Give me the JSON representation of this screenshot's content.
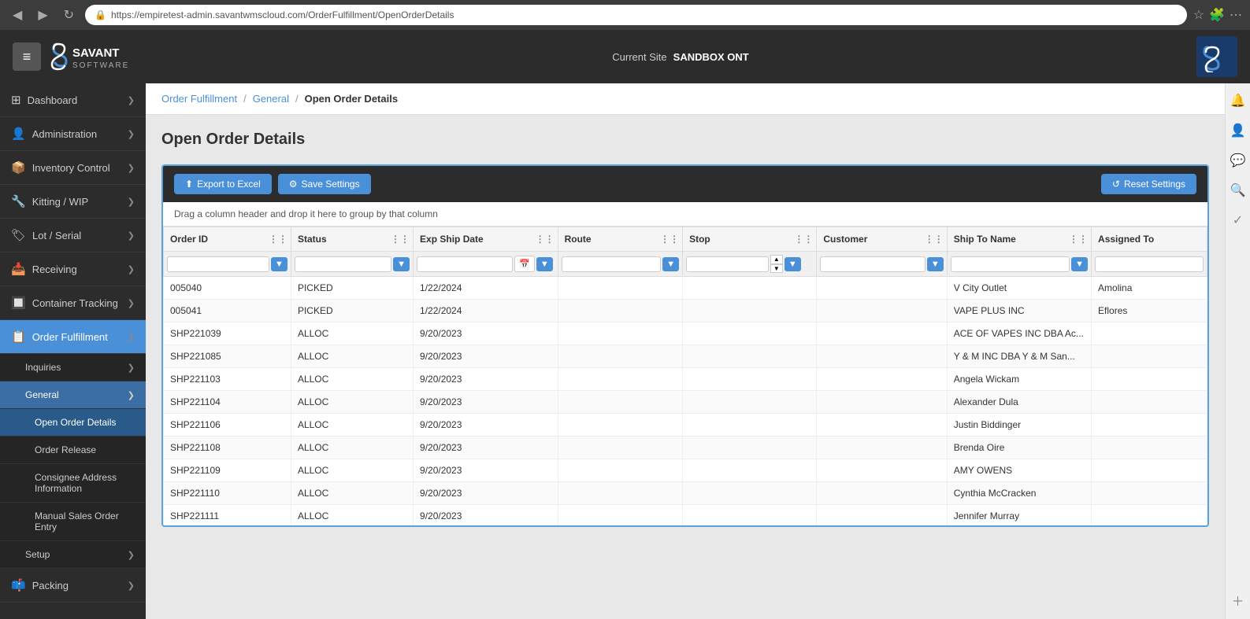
{
  "browser": {
    "url": "https://empiretest-admin.savantwmscloud.com/OrderFulfillment/OpenOrderDetails",
    "back_btn": "◀",
    "forward_btn": "▶",
    "refresh_btn": "↻"
  },
  "header": {
    "hamburger": "≡",
    "site_label": "Current Site",
    "site_name": "SANDBOX ONT",
    "logo_letter": "S"
  },
  "sidebar": {
    "items": [
      {
        "id": "dashboard",
        "icon": "⊞",
        "label": "Dashboard",
        "has_chevron": true,
        "active": false
      },
      {
        "id": "administration",
        "icon": "👤",
        "label": "Administration",
        "has_chevron": true,
        "active": false
      },
      {
        "id": "inventory-control",
        "icon": "📦",
        "label": "Inventory Control",
        "has_chevron": true,
        "active": false
      },
      {
        "id": "kitting-wip",
        "icon": "🔧",
        "label": "Kitting / WIP",
        "has_chevron": true,
        "active": false
      },
      {
        "id": "lot-serial",
        "icon": "🏷",
        "label": "Lot / Serial",
        "has_chevron": true,
        "active": false
      },
      {
        "id": "receiving",
        "icon": "📥",
        "label": "Receiving",
        "has_chevron": true,
        "active": false
      },
      {
        "id": "container-tracking",
        "icon": "📦",
        "label": "Container Tracking",
        "has_chevron": true,
        "active": false
      },
      {
        "id": "order-fulfillment",
        "icon": "📋",
        "label": "Order Fulfillment",
        "has_chevron": true,
        "active": true
      },
      {
        "id": "packing",
        "icon": "📫",
        "label": "Packing",
        "has_chevron": true,
        "active": false
      }
    ],
    "sub_items": [
      {
        "id": "inquiries",
        "label": "Inquiries",
        "has_chevron": true,
        "active": false
      },
      {
        "id": "general",
        "label": "General",
        "has_chevron": true,
        "active": true
      },
      {
        "id": "open-order-details",
        "label": "Open Order Details",
        "active": true
      },
      {
        "id": "order-release",
        "label": "Order Release",
        "active": false
      },
      {
        "id": "consignee-address",
        "label": "Consignee Address Information",
        "active": false
      },
      {
        "id": "manual-sales-order",
        "label": "Manual Sales Order Entry",
        "active": false
      },
      {
        "id": "setup",
        "label": "Setup",
        "has_chevron": true,
        "active": false
      }
    ]
  },
  "breadcrumb": {
    "items": [
      {
        "label": "Order Fulfillment",
        "link": true
      },
      {
        "label": "General",
        "link": true
      },
      {
        "label": "Open Order Details",
        "link": false,
        "current": true
      }
    ]
  },
  "page": {
    "title": "Open Order Details"
  },
  "toolbar": {
    "export_label": "Export to Excel",
    "export_icon": "⬆",
    "save_settings_label": "Save Settings",
    "save_settings_icon": "⚙",
    "reset_settings_label": "Reset Settings",
    "reset_settings_icon": "↺",
    "drag_hint": "Drag a column header and drop it here to group by that column"
  },
  "table": {
    "columns": [
      {
        "id": "order-id",
        "label": "Order ID"
      },
      {
        "id": "status",
        "label": "Status"
      },
      {
        "id": "exp-ship-date",
        "label": "Exp Ship Date",
        "has_calendar": true
      },
      {
        "id": "route",
        "label": "Route"
      },
      {
        "id": "stop",
        "label": "Stop",
        "has_spinner": true
      },
      {
        "id": "customer",
        "label": "Customer"
      },
      {
        "id": "ship-to-name",
        "label": "Ship To Name"
      },
      {
        "id": "assigned-to",
        "label": "Assigned To"
      }
    ],
    "rows": [
      {
        "order_id": "005040",
        "status": "PICKED",
        "exp_ship_date": "1/22/2024",
        "route": "",
        "stop": "",
        "customer": "",
        "ship_to_name": "V City Outlet",
        "assigned_to": "Amolina"
      },
      {
        "order_id": "005041",
        "status": "PICKED",
        "exp_ship_date": "1/22/2024",
        "route": "",
        "stop": "",
        "customer": "",
        "ship_to_name": "VAPE PLUS INC",
        "assigned_to": "Eflores"
      },
      {
        "order_id": "SHP221039",
        "status": "ALLOC",
        "exp_ship_date": "9/20/2023",
        "route": "",
        "stop": "",
        "customer": "",
        "ship_to_name": "ACE OF VAPES INC DBA Ac...",
        "assigned_to": ""
      },
      {
        "order_id": "SHP221085",
        "status": "ALLOC",
        "exp_ship_date": "9/20/2023",
        "route": "",
        "stop": "",
        "customer": "",
        "ship_to_name": "Y & M INC DBA Y & M San...",
        "assigned_to": ""
      },
      {
        "order_id": "SHP221103",
        "status": "ALLOC",
        "exp_ship_date": "9/20/2023",
        "route": "",
        "stop": "",
        "customer": "",
        "ship_to_name": "Angela Wickam",
        "assigned_to": ""
      },
      {
        "order_id": "SHP221104",
        "status": "ALLOC",
        "exp_ship_date": "9/20/2023",
        "route": "",
        "stop": "",
        "customer": "",
        "ship_to_name": "Alexander Dula",
        "assigned_to": ""
      },
      {
        "order_id": "SHP221106",
        "status": "ALLOC",
        "exp_ship_date": "9/20/2023",
        "route": "",
        "stop": "",
        "customer": "",
        "ship_to_name": "Justin Biddinger",
        "assigned_to": ""
      },
      {
        "order_id": "SHP221108",
        "status": "ALLOC",
        "exp_ship_date": "9/20/2023",
        "route": "",
        "stop": "",
        "customer": "",
        "ship_to_name": "Brenda Oire",
        "assigned_to": ""
      },
      {
        "order_id": "SHP221109",
        "status": "ALLOC",
        "exp_ship_date": "9/20/2023",
        "route": "",
        "stop": "",
        "customer": "",
        "ship_to_name": "AMY OWENS",
        "assigned_to": ""
      },
      {
        "order_id": "SHP221110",
        "status": "ALLOC",
        "exp_ship_date": "9/20/2023",
        "route": "",
        "stop": "",
        "customer": "",
        "ship_to_name": "Cynthia McCracken",
        "assigned_to": ""
      },
      {
        "order_id": "SHP221111",
        "status": "ALLOC",
        "exp_ship_date": "9/20/2023",
        "route": "",
        "stop": "",
        "customer": "",
        "ship_to_name": "Jennifer Murray",
        "assigned_to": ""
      }
    ]
  },
  "colors": {
    "primary": "#4a90d9",
    "sidebar_bg": "#2c2c2c",
    "header_bg": "#2c2c2c",
    "active_blue": "#4a90d9",
    "active_nav": "#3a6ea5"
  }
}
